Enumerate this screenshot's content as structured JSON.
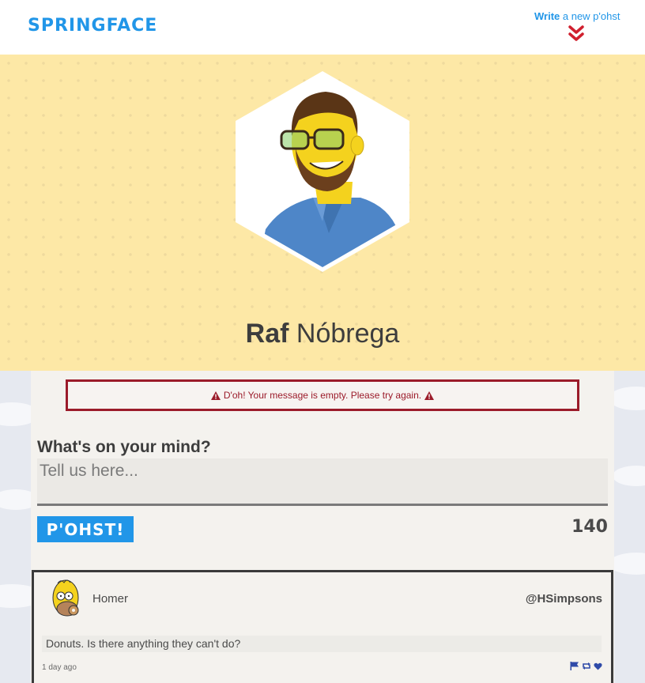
{
  "header": {
    "logo": "SPRINGFACE",
    "write_strong": "Write",
    "write_rest": " a new p'ohst",
    "accent": "#2196e8",
    "chevron_color": "#d0202e"
  },
  "profile": {
    "first_name": "Raf",
    "last_name": "Nóbrega"
  },
  "alert": {
    "message": "D'oh! Your message is empty. Please try again.",
    "color": "#9b1b2a"
  },
  "composer": {
    "question": "What's on your mind?",
    "placeholder": "Tell us here...",
    "value": "",
    "submit_label": "P'OHST!",
    "char_count": "140"
  },
  "posts": [
    {
      "author": "Homer",
      "handle": "@HSimpsons",
      "text": "Donuts. Is there anything they can't do?",
      "time": "1 day ago",
      "actions": [
        "flag-icon",
        "repost-icon",
        "heart-icon"
      ]
    }
  ]
}
